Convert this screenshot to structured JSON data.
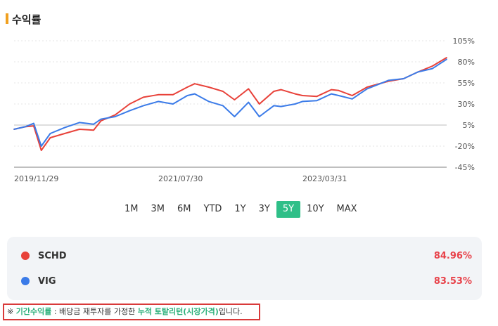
{
  "page": {
    "title": "수익률"
  },
  "chart_data": {
    "type": "line",
    "x_labels": [
      "2019/11/29",
      "2021/07/30",
      "2023/03/31"
    ],
    "y_ticks": [
      "105%",
      "80%",
      "55%",
      "30%",
      "5%",
      "-20%",
      "-45%"
    ],
    "ylim": [
      -45,
      105
    ],
    "grid": true,
    "x_start": "2019/11/29",
    "x_end": "2024/11/29",
    "series": [
      {
        "name": "SCHD",
        "color": "#e8423a",
        "dates": [
          "2019/11/29",
          "2020/01/15",
          "2020/02/20",
          "2020/03/23",
          "2020/04/30",
          "2020/06/30",
          "2020/08/31",
          "2020/10/30",
          "2020/11/30",
          "2021/01/29",
          "2021/03/31",
          "2021/05/28",
          "2021/07/30",
          "2021/09/30",
          "2021/11/30",
          "2021/12/31",
          "2022/02/28",
          "2022/04/29",
          "2022/06/17",
          "2022/08/15",
          "2022/09/30",
          "2022/11/30",
          "2022/12/30",
          "2023/02/28",
          "2023/03/31",
          "2023/05/31",
          "2023/07/31",
          "2023/08/31",
          "2023/10/27",
          "2023/12/29",
          "2024/03/28",
          "2024/05/31",
          "2024/07/31",
          "2024/09/30",
          "2024/11/29"
        ],
        "values": [
          0,
          3,
          4,
          -25,
          -10,
          -5,
          0,
          -1,
          10,
          17,
          30,
          38,
          41,
          41,
          50,
          54,
          50,
          45,
          35,
          48,
          30,
          45,
          47,
          42,
          40,
          39,
          47,
          46,
          40,
          50,
          57,
          60,
          68,
          75,
          85
        ]
      },
      {
        "name": "VIG",
        "color": "#3b7be8",
        "dates": [
          "2019/11/29",
          "2020/01/15",
          "2020/02/20",
          "2020/03/23",
          "2020/04/30",
          "2020/06/30",
          "2020/08/31",
          "2020/10/30",
          "2020/11/30",
          "2021/01/29",
          "2021/03/31",
          "2021/05/28",
          "2021/07/30",
          "2021/09/30",
          "2021/11/30",
          "2021/12/31",
          "2022/02/28",
          "2022/04/29",
          "2022/06/17",
          "2022/08/15",
          "2022/09/30",
          "2022/11/30",
          "2022/12/30",
          "2023/02/28",
          "2023/03/31",
          "2023/05/31",
          "2023/07/31",
          "2023/08/31",
          "2023/10/27",
          "2023/12/29",
          "2024/03/28",
          "2024/05/31",
          "2024/07/31",
          "2024/09/30",
          "2024/11/29"
        ],
        "values": [
          0,
          3,
          7,
          -20,
          -5,
          2,
          8,
          6,
          12,
          15,
          22,
          28,
          33,
          30,
          40,
          42,
          33,
          28,
          15,
          32,
          15,
          28,
          27,
          30,
          33,
          34,
          42,
          40,
          36,
          48,
          58,
          60,
          68,
          72,
          83
        ]
      }
    ]
  },
  "range_buttons": {
    "b1": "1M",
    "b2": "3M",
    "b3": "6M",
    "b4": "YTD",
    "b5": "1Y",
    "b6": "3Y",
    "b7": "5Y",
    "b8": "10Y",
    "b9": "MAX",
    "active": "5Y"
  },
  "legend": {
    "schd_name": "SCHD",
    "schd_value": "84.96%",
    "schd_color": "#e8423a",
    "vig_name": "VIG",
    "vig_value": "83.53%",
    "vig_color": "#3b7be8"
  },
  "note": {
    "prefix": "※ ",
    "term": "기간수익률",
    "middle": " : 배당금 재투자를 가정한 ",
    "highlight": "누적 토탈리턴(시장가격)",
    "suffix": "입니다."
  }
}
